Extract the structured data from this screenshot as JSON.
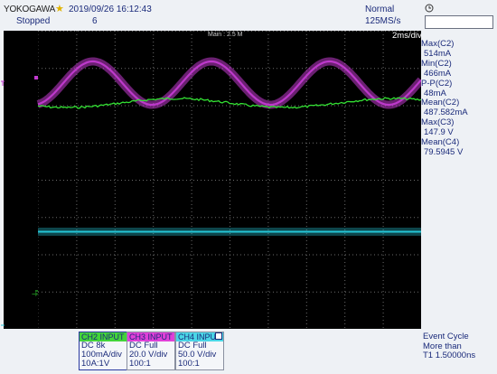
{
  "header": {
    "brand": "YOKOGAWA",
    "datetime": "2019/09/26 16:12:43",
    "run_status": "Stopped",
    "acq_count": "6",
    "acq_mode": "Normal",
    "sample_rate": "125MS/s"
  },
  "screen": {
    "zoom_label": "Main : 2.5 M",
    "timebase": "2ms/div",
    "trace_colors": {
      "ch2": "#c23bd0",
      "ch3": "#33e033",
      "ch4": "#25c5d6"
    }
  },
  "measurements": [
    {
      "label": "Max(C2)",
      "value": "514mA"
    },
    {
      "label": "Min(C2)",
      "value": "466mA"
    },
    {
      "label": "P-P(C2)",
      "value": "48mA"
    },
    {
      "label": "Mean(C2)",
      "value": "487.582mA"
    },
    {
      "label": "Max(C3)",
      "value": "147.9 V"
    },
    {
      "label": "Mean(C4)",
      "value": "79.5945 V"
    }
  ],
  "channels": {
    "ch2": {
      "title": "CH2 INPUT",
      "coupling": "DC 8k",
      "scale": "100mA/div",
      "ratio": "10A:1V"
    },
    "ch3": {
      "title": "CH3 INPUT",
      "coupling": "DC Full",
      "scale": "20.0 V/div",
      "ratio": "100:1"
    },
    "ch4": {
      "title": "CH4 INPUT",
      "coupling": "DC Full",
      "scale": "50.0 V/div",
      "ratio": "100:1"
    }
  },
  "trigger": {
    "mode": "Event Cycle",
    "condition": "More than",
    "level": "T1   1.50000ns"
  }
}
